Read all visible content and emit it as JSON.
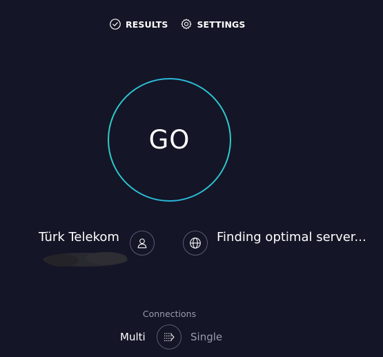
{
  "nav": {
    "results_label": "RESULTS",
    "results_icon": "check-circle-icon",
    "settings_label": "SETTINGS",
    "settings_icon": "gear-icon"
  },
  "go_button": {
    "label": "GO"
  },
  "provider": {
    "name": "Türk Telekom",
    "icon": "user-icon"
  },
  "server": {
    "status": "Finding optimal server...",
    "icon": "globe-icon"
  },
  "connections": {
    "label": "Connections",
    "options": [
      "Multi",
      "Single"
    ],
    "selected": "Multi",
    "icon": "connections-toggle-icon"
  },
  "colors": {
    "background": "#141526",
    "ring_start": "#2fcfc6",
    "ring_end": "#2ab5dd",
    "muted_text": "#9a9cb0"
  }
}
